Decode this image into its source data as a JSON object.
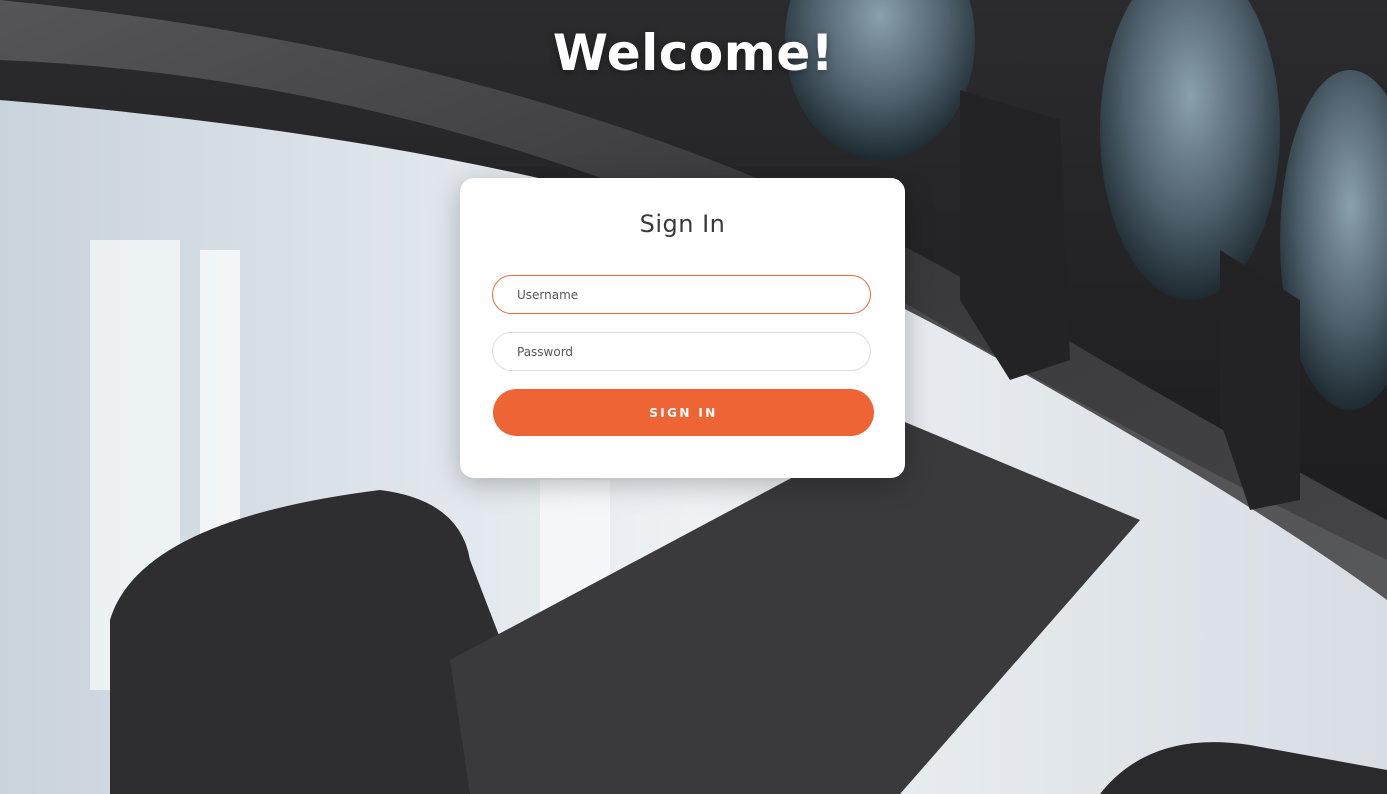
{
  "page": {
    "heading": "Welcome!"
  },
  "login_card": {
    "title": "Sign In",
    "username": {
      "placeholder": "Username",
      "value": ""
    },
    "password": {
      "placeholder": "Password",
      "value": ""
    },
    "submit_label": "SIGN IN"
  },
  "colors": {
    "accent": "#ee6435",
    "focus_border": "#e96a3a",
    "card_background": "#ffffff",
    "heading_text": "#ffffff"
  },
  "background": {
    "description_icon": "gym-dumbbell-rack-photo"
  }
}
